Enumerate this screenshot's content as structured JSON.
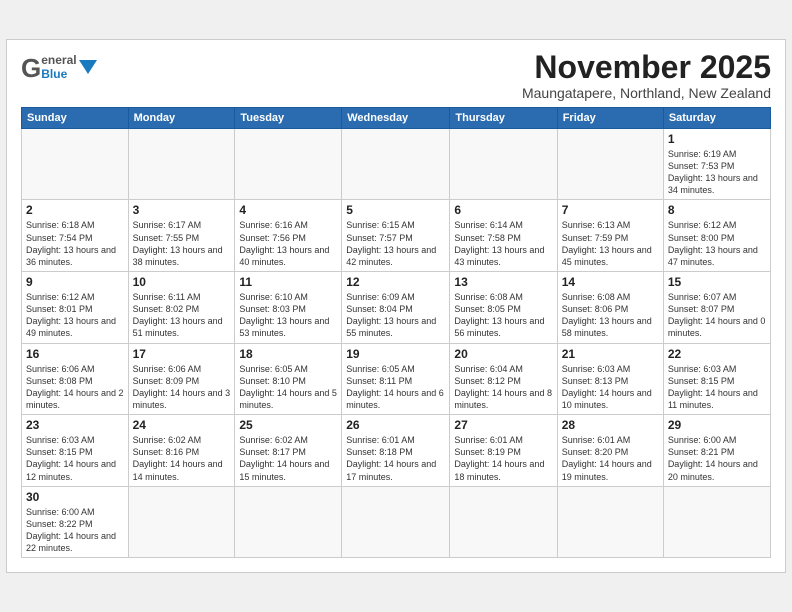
{
  "header": {
    "logo_general": "General",
    "logo_blue": "Blue",
    "month_title": "November 2025",
    "subtitle": "Maungatapere, Northland, New Zealand"
  },
  "days_of_week": [
    "Sunday",
    "Monday",
    "Tuesday",
    "Wednesday",
    "Thursday",
    "Friday",
    "Saturday"
  ],
  "weeks": [
    [
      {
        "day": "",
        "content": ""
      },
      {
        "day": "",
        "content": ""
      },
      {
        "day": "",
        "content": ""
      },
      {
        "day": "",
        "content": ""
      },
      {
        "day": "",
        "content": ""
      },
      {
        "day": "",
        "content": ""
      },
      {
        "day": "1",
        "content": "Sunrise: 6:19 AM\nSunset: 7:53 PM\nDaylight: 13 hours\nand 34 minutes."
      }
    ],
    [
      {
        "day": "2",
        "content": "Sunrise: 6:18 AM\nSunset: 7:54 PM\nDaylight: 13 hours\nand 36 minutes."
      },
      {
        "day": "3",
        "content": "Sunrise: 6:17 AM\nSunset: 7:55 PM\nDaylight: 13 hours\nand 38 minutes."
      },
      {
        "day": "4",
        "content": "Sunrise: 6:16 AM\nSunset: 7:56 PM\nDaylight: 13 hours\nand 40 minutes."
      },
      {
        "day": "5",
        "content": "Sunrise: 6:15 AM\nSunset: 7:57 PM\nDaylight: 13 hours\nand 42 minutes."
      },
      {
        "day": "6",
        "content": "Sunrise: 6:14 AM\nSunset: 7:58 PM\nDaylight: 13 hours\nand 43 minutes."
      },
      {
        "day": "7",
        "content": "Sunrise: 6:13 AM\nSunset: 7:59 PM\nDaylight: 13 hours\nand 45 minutes."
      },
      {
        "day": "8",
        "content": "Sunrise: 6:12 AM\nSunset: 8:00 PM\nDaylight: 13 hours\nand 47 minutes."
      }
    ],
    [
      {
        "day": "9",
        "content": "Sunrise: 6:12 AM\nSunset: 8:01 PM\nDaylight: 13 hours\nand 49 minutes."
      },
      {
        "day": "10",
        "content": "Sunrise: 6:11 AM\nSunset: 8:02 PM\nDaylight: 13 hours\nand 51 minutes."
      },
      {
        "day": "11",
        "content": "Sunrise: 6:10 AM\nSunset: 8:03 PM\nDaylight: 13 hours\nand 53 minutes."
      },
      {
        "day": "12",
        "content": "Sunrise: 6:09 AM\nSunset: 8:04 PM\nDaylight: 13 hours\nand 55 minutes."
      },
      {
        "day": "13",
        "content": "Sunrise: 6:08 AM\nSunset: 8:05 PM\nDaylight: 13 hours\nand 56 minutes."
      },
      {
        "day": "14",
        "content": "Sunrise: 6:08 AM\nSunset: 8:06 PM\nDaylight: 13 hours\nand 58 minutes."
      },
      {
        "day": "15",
        "content": "Sunrise: 6:07 AM\nSunset: 8:07 PM\nDaylight: 14 hours\nand 0 minutes."
      }
    ],
    [
      {
        "day": "16",
        "content": "Sunrise: 6:06 AM\nSunset: 8:08 PM\nDaylight: 14 hours\nand 2 minutes."
      },
      {
        "day": "17",
        "content": "Sunrise: 6:06 AM\nSunset: 8:09 PM\nDaylight: 14 hours\nand 3 minutes."
      },
      {
        "day": "18",
        "content": "Sunrise: 6:05 AM\nSunset: 8:10 PM\nDaylight: 14 hours\nand 5 minutes."
      },
      {
        "day": "19",
        "content": "Sunrise: 6:05 AM\nSunset: 8:11 PM\nDaylight: 14 hours\nand 6 minutes."
      },
      {
        "day": "20",
        "content": "Sunrise: 6:04 AM\nSunset: 8:12 PM\nDaylight: 14 hours\nand 8 minutes."
      },
      {
        "day": "21",
        "content": "Sunrise: 6:03 AM\nSunset: 8:13 PM\nDaylight: 14 hours\nand 10 minutes."
      },
      {
        "day": "22",
        "content": "Sunrise: 6:03 AM\nSunset: 8:15 PM\nDaylight: 14 hours\nand 11 minutes."
      }
    ],
    [
      {
        "day": "23",
        "content": "Sunrise: 6:03 AM\nSunset: 8:15 PM\nDaylight: 14 hours\nand 12 minutes."
      },
      {
        "day": "24",
        "content": "Sunrise: 6:02 AM\nSunset: 8:16 PM\nDaylight: 14 hours\nand 14 minutes."
      },
      {
        "day": "25",
        "content": "Sunrise: 6:02 AM\nSunset: 8:17 PM\nDaylight: 14 hours\nand 15 minutes."
      },
      {
        "day": "26",
        "content": "Sunrise: 6:01 AM\nSunset: 8:18 PM\nDaylight: 14 hours\nand 17 minutes."
      },
      {
        "day": "27",
        "content": "Sunrise: 6:01 AM\nSunset: 8:19 PM\nDaylight: 14 hours\nand 18 minutes."
      },
      {
        "day": "28",
        "content": "Sunrise: 6:01 AM\nSunset: 8:20 PM\nDaylight: 14 hours\nand 19 minutes."
      },
      {
        "day": "29",
        "content": "Sunrise: 6:00 AM\nSunset: 8:21 PM\nDaylight: 14 hours\nand 20 minutes."
      }
    ],
    [
      {
        "day": "30",
        "content": "Sunrise: 6:00 AM\nSunset: 8:22 PM\nDaylight: 14 hours\nand 22 minutes."
      },
      {
        "day": "",
        "content": ""
      },
      {
        "day": "",
        "content": ""
      },
      {
        "day": "",
        "content": ""
      },
      {
        "day": "",
        "content": ""
      },
      {
        "day": "",
        "content": ""
      },
      {
        "day": "",
        "content": ""
      }
    ]
  ]
}
